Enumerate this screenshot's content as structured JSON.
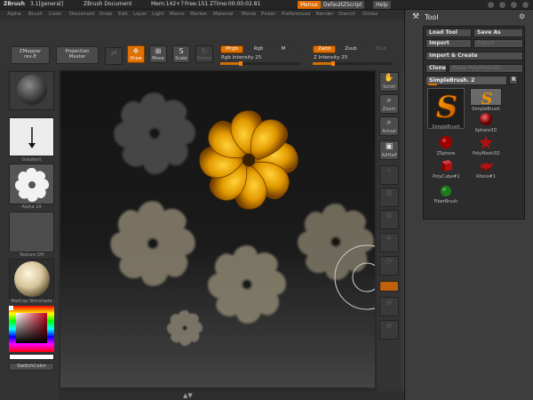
{
  "titlebar": {
    "app": "ZBrush",
    "version": "3.1[general]",
    "document": "ZBrush Document",
    "mem": "Mem:142+7",
    "free": "Free:151",
    "ztime": "ZTime:00:00:02.81",
    "menus_button": "Menus",
    "script_button": "DefaultZScript",
    "help_button": "Help"
  },
  "menubar": [
    "Alpha",
    "Brush",
    "Color",
    "Document",
    "Draw",
    "Edit",
    "Layer",
    "Light",
    "Macro",
    "Marker",
    "Material",
    "Movie",
    "Picker",
    "Preferences",
    "Render",
    "Stencil",
    "Stroke"
  ],
  "shelf": {
    "zmapper": "ZMapper",
    "zmapper_rev": "rev-E",
    "projection": "Projection",
    "projection_master": "Master",
    "draw": "Draw",
    "move": "Move",
    "scale": "Scale",
    "rotate": "Rotate",
    "mrgb": "Mrgb",
    "rgb": "Rgb",
    "m": "M",
    "rgb_intensity": "Rgb Intensity 25",
    "rgb_intensity_value": 25,
    "zadd": "Zadd",
    "zsub": "Zsub",
    "zcut": "Zcut",
    "z_intensity": "Z Intensity 25",
    "z_intensity_value": 25
  },
  "left": {
    "gradient": "Gradient",
    "alpha": "Alpha 19",
    "texture": "Texture Off",
    "material": "MatCap Skinshade",
    "switch_color": "SwitchColor"
  },
  "right": [
    "Scroll",
    "Zoom",
    "Actual",
    "AAHalf",
    "",
    "",
    "",
    "",
    "",
    ""
  ],
  "tool": {
    "title": "Tool",
    "load_tool": "Load Tool",
    "save_as": "Save As",
    "import": "Import",
    "export": "Export",
    "import_create": "Import & Create",
    "clone": "Clone",
    "make_polymesh": "Make PolyMesh3D",
    "current_tool": "SimpleBrush. 2",
    "r_button": "R",
    "items": [
      {
        "label": "SimpleBrush",
        "shape": "s-brush"
      },
      {
        "label": "Sphere3D",
        "shape": "sphere"
      },
      {
        "label": "ZSphere",
        "shape": "zsphere"
      },
      {
        "label": "PolyMesh3D",
        "shape": "star"
      },
      {
        "label": "PolyCube#1",
        "shape": "cube"
      },
      {
        "label": "Rhino#1",
        "shape": "rhino"
      },
      {
        "label": "FiberBrush",
        "shape": "fiber"
      }
    ]
  },
  "colors": {
    "accent": "#e07000",
    "background": "#3a3a3a"
  }
}
